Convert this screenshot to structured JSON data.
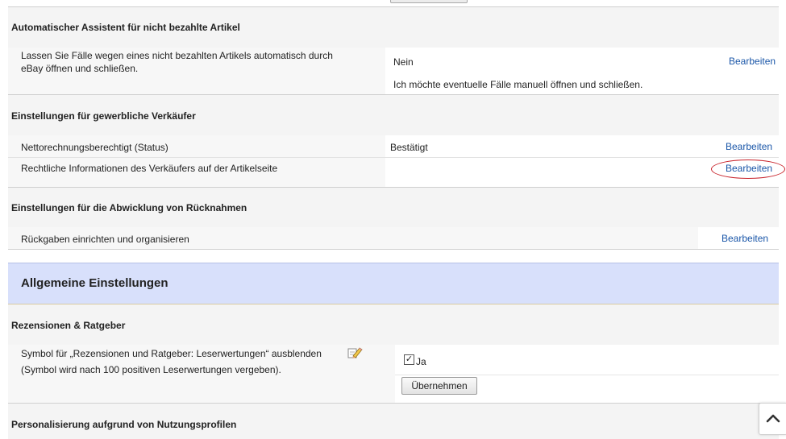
{
  "unpaid": {
    "title": "Automatischer Assistent für nicht bezahlte Artikel",
    "row": {
      "label_line1": "Lassen Sie Fälle wegen eines nicht bezahlten Artikels automatisch durch",
      "label_line2": "eBay öffnen und schließen.",
      "value": "Nein",
      "note": "Ich möchte eventuelle Fälle manuell öffnen und schließen.",
      "edit": "Bearbeiten"
    }
  },
  "business": {
    "title": "Einstellungen für gewerbliche Verkäufer",
    "rows": [
      {
        "label": "Nettorechnungsberechtigt (Status)",
        "value": "Bestätigt",
        "edit": "Bearbeiten"
      },
      {
        "label": "Rechtliche Informationen des Verkäufers auf der Artikelseite",
        "value": "",
        "edit": "Bearbeiten"
      }
    ]
  },
  "returns": {
    "title": "Einstellungen für die Abwicklung von Rücknahmen",
    "row": {
      "label": "Rückgaben einrichten und organisieren",
      "edit": "Bearbeiten"
    }
  },
  "general": {
    "title": "Allgemeine Einstellungen"
  },
  "reviews": {
    "title": "Rezensionen & Ratgeber",
    "label_line1": "Symbol für „Rezensionen und Ratgeber: Leserwertungen“ ausblenden",
    "label_line2": "(Symbol wird nach 100 positiven Leserwertungen vergeben).",
    "checkbox_label": "Ja",
    "checked": true,
    "apply": "Übernehmen"
  },
  "personalization": {
    "title": "Personalisierung aufgrund von Nutzungsprofilen"
  },
  "colors": {
    "link": "#1a56a8",
    "band": "#d8e0fb",
    "highlight": "#c8222a"
  },
  "icons": {
    "pencil": "pencil-icon",
    "scroll": "chevron-up-icon"
  }
}
